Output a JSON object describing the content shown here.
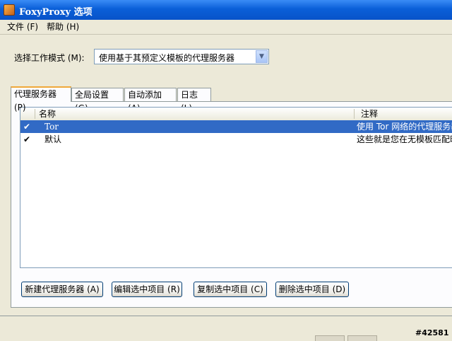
{
  "window": {
    "title": "FoxyProxy 选项"
  },
  "menu": [
    {
      "label": "文件 (F)"
    },
    {
      "label": "帮助 (H)"
    }
  ],
  "mode": {
    "label": "选择工作模式 (M):",
    "selected": "使用基于其预定义模板的代理服务器"
  },
  "tabs": [
    {
      "label": "代理服务器 (P)",
      "active": true
    },
    {
      "label": "全局设置 (G)"
    },
    {
      "label": "自动添加 (A)"
    },
    {
      "label": "日志 (L)"
    }
  ],
  "list": {
    "columns": [
      "名称",
      "注释"
    ],
    "rows": [
      {
        "check": "✔",
        "name": "Tor",
        "note": "使用 Tor 网络的代理服务器",
        "selected": true
      },
      {
        "check": "✔",
        "name": "默认",
        "note": "这些就是您在无模板匹配时",
        "selected": false
      }
    ]
  },
  "buttons": {
    "new": "新建代理服务器 (A)",
    "edit": "编辑选中项目 (R)",
    "copy": "复制选中项目 (C)",
    "delete": "删除选中项目 (D)"
  },
  "stamp": "#42581"
}
